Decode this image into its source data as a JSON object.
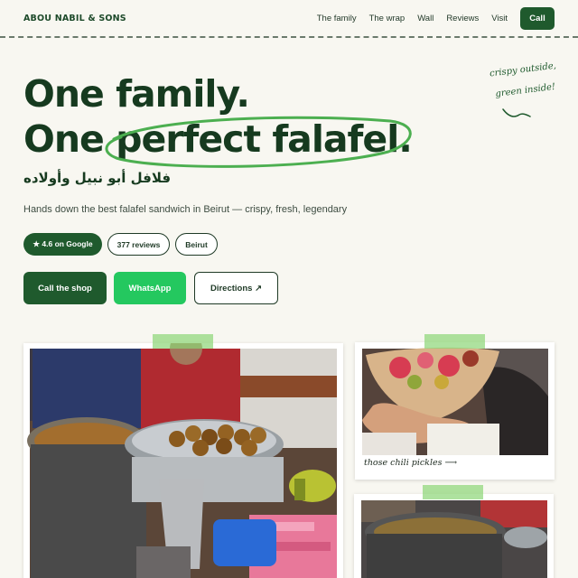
{
  "header": {
    "brand": "ABOU NABIL & SONS",
    "nav": [
      "The family",
      "The wrap",
      "Wall",
      "Reviews",
      "Visit"
    ],
    "call_label": "Call"
  },
  "hero": {
    "line1": "One family.",
    "line2": "One perfect falafel.",
    "arabic": "فلافل أبو نبيل وأولاده",
    "tagline": "Hands down the best falafel sandwich in Beirut — crispy, fresh, legendary",
    "side_note_line1": "crispy outside,",
    "side_note_line2": "green inside!"
  },
  "pills": {
    "rating": "★ 4.6 on Google",
    "reviews": "377 reviews",
    "location": "Beirut"
  },
  "cta": {
    "call": "Call the shop",
    "whatsapp": "WhatsApp",
    "directions": "Directions ↗"
  },
  "photos": {
    "caption": "those chili pickles ⟶"
  },
  "colors": {
    "background": "#f8f7f1",
    "primary": "#1f5a2d",
    "whatsapp": "#24c85f",
    "scribble": "#4caf50"
  }
}
